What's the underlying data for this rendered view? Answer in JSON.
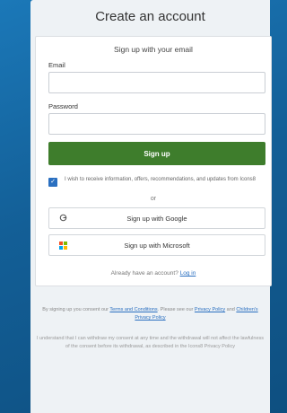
{
  "page": {
    "title": "Create an account"
  },
  "card": {
    "subtitle": "Sign up with your email",
    "email_label": "Email",
    "email_value": "",
    "password_label": "Password",
    "password_value": "",
    "signup_button": "Sign up",
    "consent_checked": true,
    "consent_text": "I wish to receive information, offers, recommendations, and updates from Icons8",
    "or_text": "or",
    "google_button": "Sign up with Google",
    "microsoft_button": "Sign up with Microsoft",
    "already_text": "Already have an account?",
    "login_link": "Log in"
  },
  "legal": {
    "line1": "By signing up you consent our",
    "terms_link": "Terms and Conditions",
    "line1b": ". Please see our",
    "privacy_link": "Privacy Policy",
    "and_text": "and",
    "children_link": "Children's Privacy Policy",
    "paragraph": "I understand that I can withdraw my consent at any time and the withdrawal will not affect the lawfulness of the consent before its withdrawal, as described in the Icons8 Privacy Policy"
  },
  "colors": {
    "primary_button": "#3e7d2c",
    "background": "#135f97",
    "link": "#2a6fc0"
  },
  "icons": {
    "google": "google-icon",
    "microsoft": "microsoft-icon",
    "checkbox": "check-icon"
  }
}
